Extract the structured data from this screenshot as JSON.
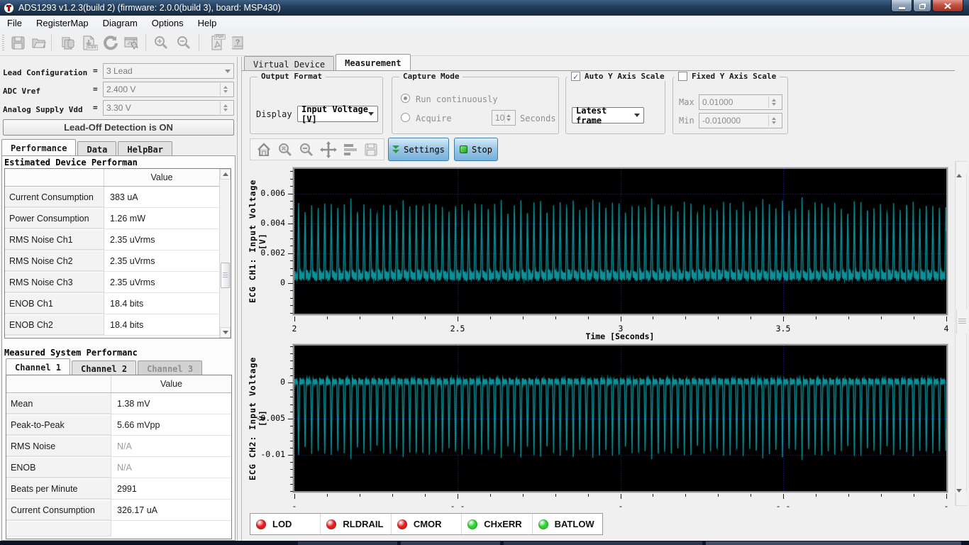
{
  "window": {
    "title": "ADS1293 v1.2.3(build 2) (firmware: 2.0.0(build 3), board: MSP430)"
  },
  "menu": {
    "items": [
      "File",
      "RegisterMap",
      "Diagram",
      "Options",
      "Help"
    ]
  },
  "toolbar": {
    "icons": [
      "save",
      "open",
      "copy",
      "export-csv",
      "refresh",
      "export-chart",
      "zoom-in",
      "zoom-out",
      "export-pdf",
      "help"
    ],
    "csv_badge": "CSV",
    "pdf_badge": "PDF",
    "help_glyph": "?"
  },
  "sidebar": {
    "equals": "=",
    "fields": [
      {
        "label": "Lead Configuration",
        "value": "3 Lead",
        "type": "dropdown"
      },
      {
        "label": "ADC Vref",
        "value": "2.400 V",
        "type": "spinner"
      },
      {
        "label": "Analog Supply Vdd",
        "value": "3.30 V",
        "type": "spinner"
      }
    ],
    "leadoff_button": "Lead-Off Detection is ON",
    "tabs": [
      "Performance",
      "Data",
      "HelpBar"
    ],
    "estimated": {
      "title": "Estimated Device Performan",
      "value_header": "Value",
      "rows": [
        {
          "name": "Current Consumption",
          "value": "383 uA"
        },
        {
          "name": "Power Consumption",
          "value": "1.26 mW"
        },
        {
          "name": "RMS Noise Ch1",
          "value": "2.35 uVrms"
        },
        {
          "name": "RMS Noise Ch2",
          "value": "2.35 uVrms"
        },
        {
          "name": "RMS Noise Ch3",
          "value": "2.35 uVrms"
        },
        {
          "name": "ENOB Ch1",
          "value": "18.4 bits"
        },
        {
          "name": "ENOB Ch2",
          "value": "18.4 bits"
        }
      ]
    },
    "measured": {
      "title": "Measured System Performanc",
      "tabs": [
        "Channel 1",
        "Channel 2",
        "Channel 3"
      ],
      "value_header": "Value",
      "rows": [
        {
          "name": "Mean",
          "value": "1.38 mV",
          "muted": false
        },
        {
          "name": "Peak-to-Peak",
          "value": "5.66 mVpp",
          "muted": false
        },
        {
          "name": "RMS Noise",
          "value": "N/A",
          "muted": true
        },
        {
          "name": "ENOB",
          "value": "N/A",
          "muted": true
        },
        {
          "name": "Beats per Minute",
          "value": "2991",
          "muted": false
        },
        {
          "name": "Current Consumption",
          "value": "326.17 uA",
          "muted": false
        }
      ]
    }
  },
  "main": {
    "tabs": [
      "Virtual Device",
      "Measurement"
    ],
    "output_format": {
      "legend": "Output Format",
      "display_label": "Display",
      "display_value": "Input Voltage [V]"
    },
    "capture_mode": {
      "legend": "Capture Mode",
      "run_label": "Run continuously",
      "acquire_label": "Acquire",
      "seconds_value": "10",
      "seconds_label": "Seconds"
    },
    "auto_y": {
      "legend": "Auto Y Axis Scale",
      "checked": true,
      "check_glyph": "✓",
      "frame_value": "Latest frame"
    },
    "fixed_y": {
      "legend": "Fixed Y Axis Scale",
      "checked": false,
      "max_label": "Max",
      "max_value": "0.01000",
      "min_label": "Min",
      "min_value": "-0.010000"
    },
    "chart_toolbar": {
      "settings_label": "Settings",
      "stop_label": "Stop"
    },
    "indicators": [
      {
        "label": "LOD",
        "color": "#e41e1e"
      },
      {
        "label": "RLDRAIL",
        "color": "#e41e1e"
      },
      {
        "label": "CMOR",
        "color": "#e41e1e"
      },
      {
        "label": "CHxERR",
        "color": "#2bd42b"
      },
      {
        "label": "BATLOW",
        "color": "#2bd42b"
      }
    ]
  },
  "chart_data": [
    {
      "type": "line",
      "ylabel": "ECG CH1: Input Voltage [V]",
      "xlabel": "Time [Seconds]",
      "xlim": [
        2,
        4
      ],
      "ylim": [
        -0.00205,
        0.00765
      ],
      "yticks": [
        {
          "v": 0.006,
          "label": "0.006"
        },
        {
          "v": 0.004,
          "label": "0.004"
        },
        {
          "v": 0.002,
          "label": "0.002"
        },
        {
          "v": 0,
          "label": "0"
        }
      ],
      "y_minor_step": 0.0005,
      "xticks": [
        {
          "v": 2,
          "label": "2"
        },
        {
          "v": 2.5,
          "label": "2.5"
        },
        {
          "v": 3,
          "label": "3"
        },
        {
          "v": 3.5,
          "label": "3.5"
        },
        {
          "v": 4,
          "label": "4"
        }
      ],
      "x_minor_step": 0.1,
      "line_color": "#0d9199",
      "bg": "#000000",
      "grid_color": "#2525dd",
      "wave": {
        "freq_hz": 49.85,
        "peak_min": 0.0051,
        "peak_max": 0.0058,
        "polarity": 1
      },
      "shape": [
        [
          0,
          0.0007
        ],
        [
          0.06,
          0.0001
        ],
        [
          0.12,
          0.0009
        ],
        [
          0.18,
          0.0001
        ],
        [
          0.34,
          null
        ],
        [
          0.5,
          0.0001
        ],
        [
          0.57,
          0.001
        ],
        [
          0.64,
          0.0002
        ],
        [
          0.72,
          0.0009
        ],
        [
          0.8,
          0.0001
        ],
        [
          0.88,
          0.0008
        ],
        [
          0.94,
          0.0002
        ],
        [
          1,
          0.0007
        ]
      ]
    },
    {
      "type": "line",
      "ylabel": "ECG CH2: Input Voltage [V]",
      "xlabel": "",
      "xlim": [
        2,
        4
      ],
      "ylim": [
        -0.015,
        0.0051
      ],
      "yticks": [
        {
          "v": 0,
          "label": "0"
        },
        {
          "v": -0.005,
          "label": "-0.005"
        },
        {
          "v": -0.01,
          "label": "-0.01"
        }
      ],
      "y_minor_step": 0.001,
      "xticks": [
        {
          "v": 2,
          "label": "-"
        },
        {
          "v": 2.5,
          "label": "- -"
        },
        {
          "v": 3,
          "label": "-"
        },
        {
          "v": 3.5,
          "label": "- -"
        },
        {
          "v": 4,
          "label": "-"
        }
      ],
      "x_minor_step": 0.1,
      "line_color": "#0d9199",
      "bg": "#000000",
      "grid_color": "#2525dd",
      "wave": {
        "freq_hz": 49.85,
        "peak_min": 0.0097,
        "peak_max": 0.0108,
        "polarity": -1
      },
      "shape": [
        [
          0,
          -0.0002
        ],
        [
          0.06,
          0.0006
        ],
        [
          0.13,
          -0.0003
        ],
        [
          0.19,
          0.0005
        ],
        [
          0.34,
          null
        ],
        [
          0.5,
          -0.0002
        ],
        [
          0.57,
          0.0007
        ],
        [
          0.64,
          -0.0003
        ],
        [
          0.72,
          0.0006
        ],
        [
          0.8,
          -0.0004
        ],
        [
          0.88,
          0.0005
        ],
        [
          0.94,
          -0.0002
        ],
        [
          1,
          -0.0002
        ]
      ]
    }
  ]
}
